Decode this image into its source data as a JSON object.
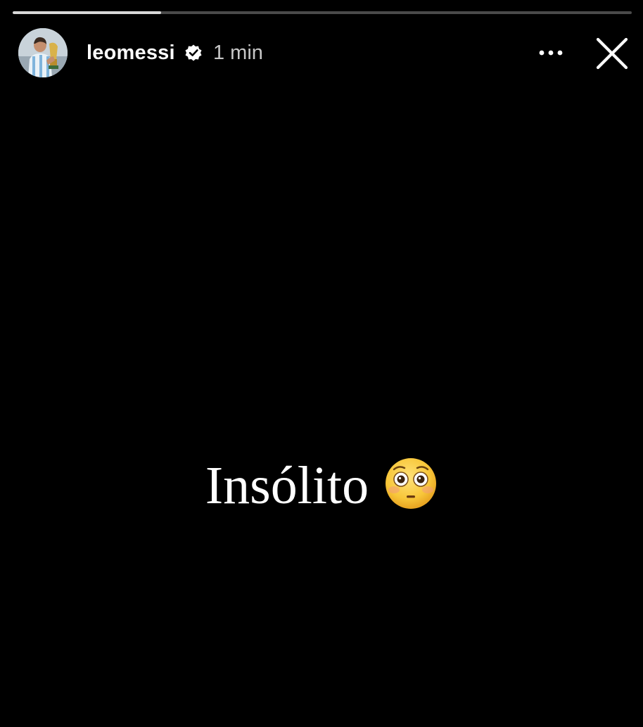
{
  "story": {
    "progress": 0.24,
    "user": {
      "username": "leomessi",
      "verified": true,
      "avatar_icon": "avatar-photo-icon"
    },
    "timestamp": "1 min",
    "menu_icon": "more-options-icon",
    "close_icon": "close-icon",
    "text": "Insólito",
    "emoji": "flushed-face-emoji"
  },
  "colors": {
    "background": "#000000",
    "text": "#ffffff",
    "timestamp": "#c7c7c7",
    "progress_track": "#4a4a4a",
    "progress_fill": "#d8d8d8"
  }
}
